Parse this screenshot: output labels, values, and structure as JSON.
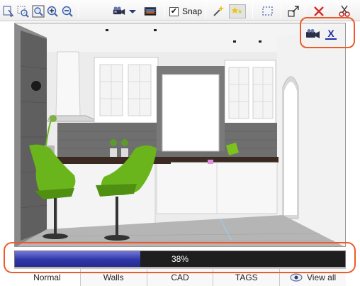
{
  "toolbar": {
    "snap_label": "Snap",
    "snap_checked_mark": "✔",
    "tools": [
      {
        "name": "select-icon"
      },
      {
        "name": "zoom-region-icon"
      },
      {
        "name": "zoom-fit-icon"
      },
      {
        "name": "zoom-in-icon"
      },
      {
        "name": "zoom-out-icon"
      },
      {
        "name": "camera-icon"
      },
      {
        "name": "dropdown-arrow-icon"
      },
      {
        "name": "film-icon"
      },
      {
        "name": "magic-wand-icon"
      },
      {
        "name": "snap-star-icon"
      },
      {
        "name": "dotted-select-icon"
      },
      {
        "name": "resize-icon"
      },
      {
        "name": "delete-x-icon"
      },
      {
        "name": "cut-icon"
      }
    ]
  },
  "viewport": {
    "camera_close": "X",
    "wall_color": "#f0f0f0",
    "tile_color": "#6f6f6f",
    "chair_color": "#6bb51c"
  },
  "progress": {
    "percent": 38,
    "label": "38%",
    "fill_color": "#2e35a8"
  },
  "tabs": [
    {
      "label": "Normal",
      "active": true
    },
    {
      "label": "Walls",
      "active": false
    },
    {
      "label": "CAD",
      "active": false
    },
    {
      "label": "TAGS",
      "active": false
    },
    {
      "label": "View all",
      "active": false
    }
  ],
  "colors": {
    "highlight": "#f05a28"
  }
}
